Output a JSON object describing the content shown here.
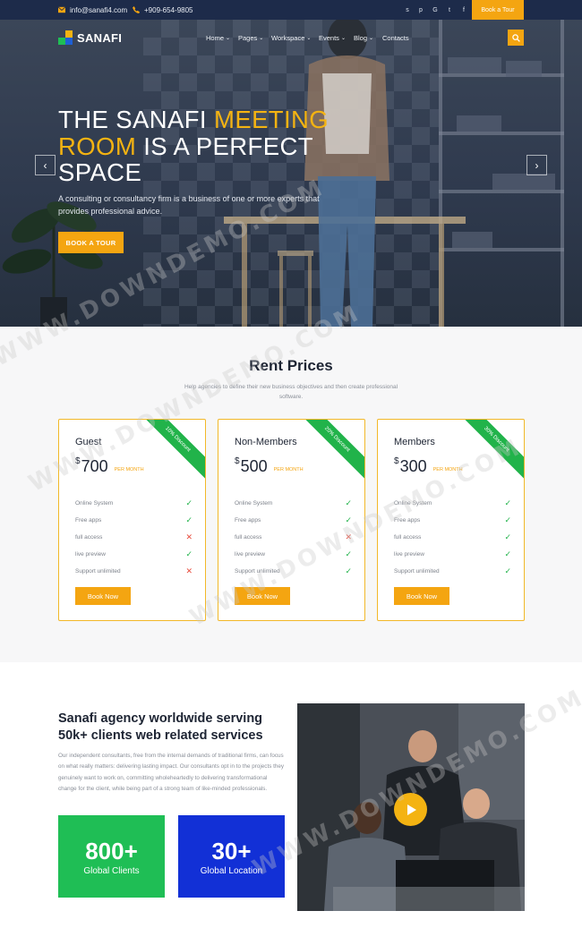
{
  "topbar": {
    "email": "info@sanafi4.com",
    "phone": "+909-654-9805",
    "social_icons": [
      "skype-icon",
      "pinterest-icon",
      "google-icon",
      "twitter-icon",
      "facebook-icon"
    ],
    "social_glyphs": [
      "s",
      "p",
      "G",
      "t",
      "f"
    ],
    "tour_label": "Book a Tour"
  },
  "brand": {
    "name": "SANAFI",
    "accent": "#f4a511",
    "navy": "#1d2b4a"
  },
  "nav": {
    "items": [
      {
        "label": "Home",
        "dropdown": true
      },
      {
        "label": "Pages",
        "dropdown": true
      },
      {
        "label": "Workspace",
        "dropdown": true
      },
      {
        "label": "Events",
        "dropdown": true
      },
      {
        "label": "Blog",
        "dropdown": true
      },
      {
        "label": "Contacts",
        "dropdown": false
      }
    ]
  },
  "hero": {
    "title_part1": "THE SANAFI ",
    "title_accent1": "MEETING",
    "title_accent2": "ROOM",
    "title_part2": " IS A PERFECT SPACE",
    "description": "A consulting or consultancy firm is a business of one or more experts that provides professional advice.",
    "button_label": "BOOK A TOUR",
    "prev_glyph": "‹",
    "next_glyph": "›"
  },
  "pricing": {
    "title": "Rent Prices",
    "subtitle": "Help agencies to define their new business objectives and then create professional software.",
    "plans": [
      {
        "name": "Guest",
        "currency": "$",
        "amount": "700",
        "period": "PER MONTH",
        "discount": "10% Discount",
        "features": [
          {
            "label": "Online System",
            "included": true
          },
          {
            "label": "Free apps",
            "included": true
          },
          {
            "label": "full access",
            "included": false
          },
          {
            "label": "live preview",
            "included": true
          },
          {
            "label": "Support unlimited",
            "included": false
          }
        ],
        "button_label": "Book Now"
      },
      {
        "name": "Non-Members",
        "currency": "$",
        "amount": "500",
        "period": "PER MONTH",
        "discount": "20% Discount",
        "features": [
          {
            "label": "Online System",
            "included": true
          },
          {
            "label": "Free apps",
            "included": true
          },
          {
            "label": "full access",
            "included": false
          },
          {
            "label": "live preview",
            "included": true
          },
          {
            "label": "Support unlimited",
            "included": true
          }
        ],
        "button_label": "Book Now"
      },
      {
        "name": "Members",
        "currency": "$",
        "amount": "300",
        "period": "PER MONTH",
        "discount": "30% Discount",
        "features": [
          {
            "label": "Online System",
            "included": true
          },
          {
            "label": "Free apps",
            "included": true
          },
          {
            "label": "full access",
            "included": true
          },
          {
            "label": "live preview",
            "included": true
          },
          {
            "label": "Support unlimited",
            "included": true
          }
        ],
        "button_label": "Book Now"
      }
    ],
    "check_glyph": "✓",
    "cross_glyph": "✕",
    "check_color": "#21b34a",
    "cross_color": "#e84c3d"
  },
  "about": {
    "title": "Sanafi agency worldwide serving 50k+ clients web related services",
    "text": "Our independent consultants, free from the internal demands of traditional firms, can focus on what really matters: delivering lasting impact. Our consultants opt in to the projects they genuinely want to work on, committing wholeheartedly to delivering transformational change for the client, while being part of a strong team of like-minded professionals.",
    "stats": [
      {
        "number": "800+",
        "label": "Global Clients",
        "color": "#1fbe55"
      },
      {
        "number": "30+",
        "label": "Global Location",
        "color": "#1230d6"
      }
    ]
  },
  "watermark": "WWW.DOWNDEMO.COM"
}
